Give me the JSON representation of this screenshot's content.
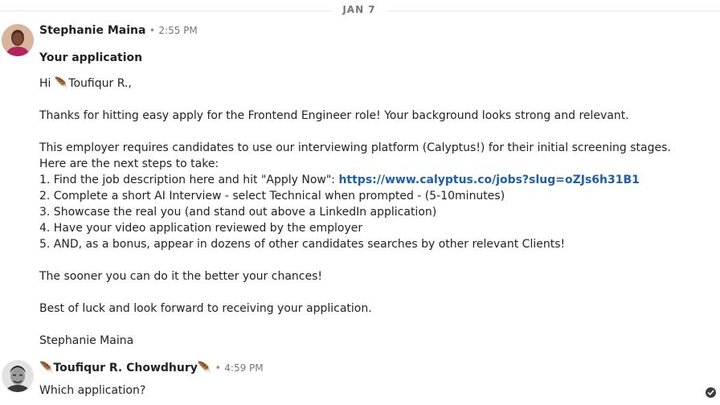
{
  "divider": {
    "date": "JAN 7"
  },
  "message1": {
    "sender": "Stephanie Maina",
    "separator": "•",
    "time": "2:55 PM",
    "subject": "Your application",
    "greeting": "Hi 🪶Toufiqur R.,",
    "para1": "Thanks for hitting easy apply for the Frontend Engineer role! Your background looks strong and relevant.",
    "para2": "This employer requires candidates to use our interviewing platform (Calyptus!) for their initial screening stages. Here are the next steps to take:",
    "step1_prefix": "1. Find the job description here and hit \"Apply Now\": ",
    "step1_link": "https://www.calyptus.co/jobs?slug=oZJs6h31B1",
    "step2": "2. Complete a short AI Interview - select Technical when prompted - (5-10minutes)",
    "step3": "3. Showcase the real you (and stand out above a LinkedIn application)",
    "step4": "4. Have your video application reviewed by the employer",
    "step5": "5. AND, as a bonus, appear in dozens of other candidates searches by other relevant Clients!",
    "para3": "The sooner you can do it the better your chances!",
    "para4": "Best of luck and look forward to receiving your application.",
    "signature": "Stephanie Maina"
  },
  "message2": {
    "sender": "🪶Toufiqur R. Chowdhury🪶",
    "separator": "•",
    "time": "4:59 PM",
    "text": "Which application?"
  },
  "icons": {
    "read_status": "check-circle-icon"
  },
  "colors": {
    "link": "#1d5fa8",
    "divider_text": "#777777"
  }
}
